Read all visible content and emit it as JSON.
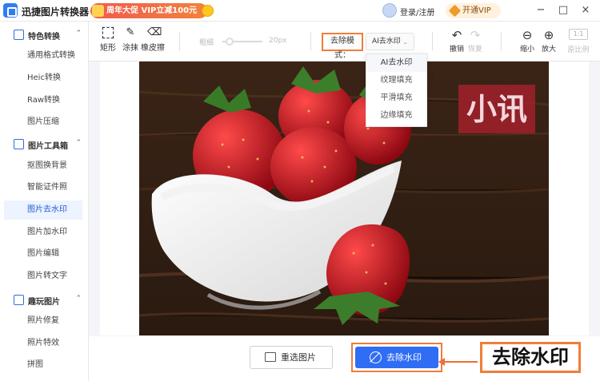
{
  "app": {
    "title": "迅捷图片转换器"
  },
  "promo": {
    "text": "周年大促 VIP立减100元"
  },
  "header": {
    "login": "登录/注册",
    "vip": "开通VIP"
  },
  "window": {
    "minimize": "−",
    "maximize": "□",
    "close": "×"
  },
  "sidebar": {
    "groups": [
      {
        "label": "特色转换",
        "items": [
          "通用格式转换",
          "Heic转换",
          "Raw转换",
          "图片压缩"
        ]
      },
      {
        "label": "图片工具箱",
        "items": [
          "抠图换背景",
          "智能证件照",
          "图片去水印",
          "图片加水印",
          "图片编辑",
          "图片转文字"
        ]
      },
      {
        "label": "趣玩图片",
        "items": [
          "照片修复",
          "照片特效",
          "拼图"
        ]
      }
    ],
    "active_item": "图片去水印",
    "chevron": "⌃"
  },
  "toolbar": {
    "tools": [
      {
        "label": "矩形",
        "icon": "rectangle-select-icon"
      },
      {
        "label": "涂抹",
        "icon": "brush-icon"
      },
      {
        "label": "橡皮擦",
        "icon": "eraser-icon"
      }
    ],
    "thickness_label": "粗细",
    "size_value": "20px",
    "mode_label": "去除模式：",
    "mode_value": "AI去水印",
    "undo": "撤销",
    "redo": "恢复",
    "zoom_out": "缩小",
    "zoom_in": "放大",
    "ratio_value": "1:1",
    "ratio_label": "原比例"
  },
  "dropdown": {
    "options": [
      "AI去水印",
      "纹理填充",
      "平滑填充",
      "边缘填充"
    ]
  },
  "canvas": {
    "watermark_text": "小讯"
  },
  "actions": {
    "reselect": "重选图片",
    "remove_watermark": "去除水印"
  },
  "annotation": {
    "callout": "去除水印"
  },
  "colors": {
    "accent": "#2f6df5",
    "highlight": "#f07d39",
    "active_bg": "#edf3ff"
  }
}
